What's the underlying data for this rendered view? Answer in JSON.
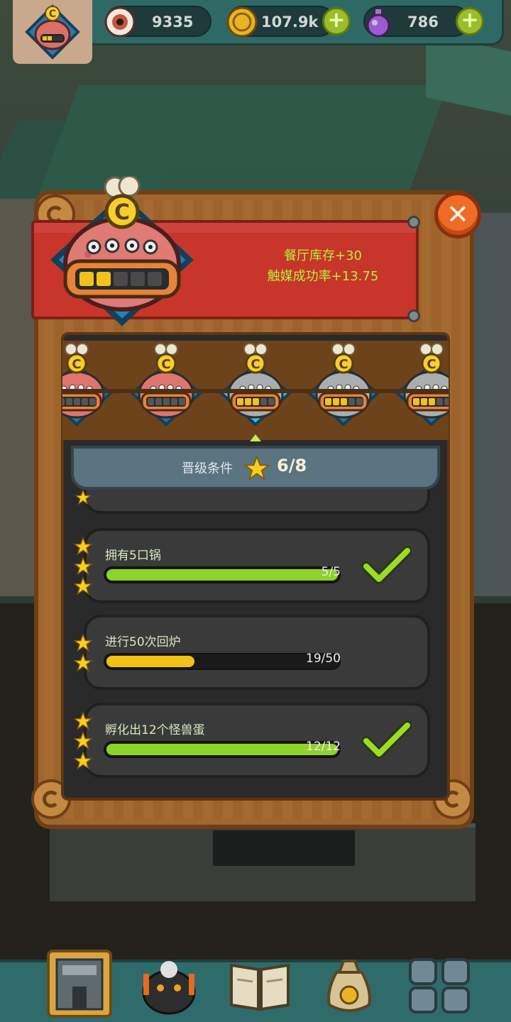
{
  "resources": {
    "eyes": "9335",
    "coins": "107.9k",
    "potions": "786"
  },
  "banner": {
    "bonus1": "餐厅库存+30",
    "bonus2": "触媒成功率+13.75"
  },
  "levels": {
    "rank_letter": "C"
  },
  "conditions": {
    "label": "晋级条件",
    "count": "6/8"
  },
  "tasks": [
    {
      "title": "拥有5口锅",
      "progress": "5/5",
      "fraction": 1.0,
      "stars": 3,
      "done": true
    },
    {
      "title": "进行50次回炉",
      "progress": "19/50",
      "fraction": 0.38,
      "stars": 2,
      "done": false
    },
    {
      "title": "孵化出12个怪兽蛋",
      "progress": "12/12",
      "fraction": 1.0,
      "stars": 3,
      "done": true
    }
  ],
  "colors": {
    "done_fill": "#8fd22a",
    "partial_fill": "#f2c21b",
    "banner_red": "#c8352a",
    "accent_green": "#b7f13a"
  },
  "icons": {
    "eye": "eyeball-icon",
    "coin": "coin-icon",
    "potion": "potion-icon",
    "close": "close-icon",
    "star": "star-icon",
    "check": "checkmark-icon"
  },
  "nav": {
    "items": [
      "restaurant-nav",
      "monster-nav",
      "recipe-book-nav",
      "coin-bag-nav",
      "grid-menu-nav"
    ]
  }
}
